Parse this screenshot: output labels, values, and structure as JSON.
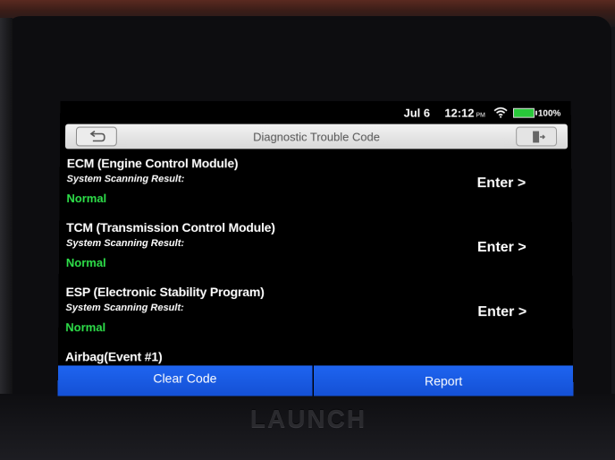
{
  "status_bar": {
    "date": "Jul 6",
    "time": "12:12",
    "ampm": "PM",
    "battery": "100%",
    "battery_level": 1.0,
    "battery_color": "#29c83a",
    "wifi_icon": "wifi-icon"
  },
  "title_bar": {
    "title": "Diagnostic Trouble Code",
    "back_icon": "back-arrow-icon",
    "exit_icon": "exit-icon"
  },
  "modules": [
    {
      "name": "ECM (Engine Control Module)",
      "result_label": "System Scanning Result:",
      "status": "Normal",
      "action": "Enter >"
    },
    {
      "name": "TCM (Transmission Control Module)",
      "result_label": "System Scanning Result:",
      "status": "Normal",
      "action": "Enter >"
    },
    {
      "name": "ESP (Electronic Stability Program)",
      "result_label": "System Scanning Result:",
      "status": "Normal",
      "action": "Enter >"
    },
    {
      "name": "Airbag(Event #1)",
      "result_label": "",
      "status": "",
      "action": ""
    }
  ],
  "actions": {
    "clear_code": "Clear Code",
    "report": "Report"
  },
  "device": {
    "brand": "LAUNCH"
  },
  "colors": {
    "accent": "#1e64f0",
    "status_normal": "#2ee04a",
    "title_bar": "#e4e4e4"
  }
}
